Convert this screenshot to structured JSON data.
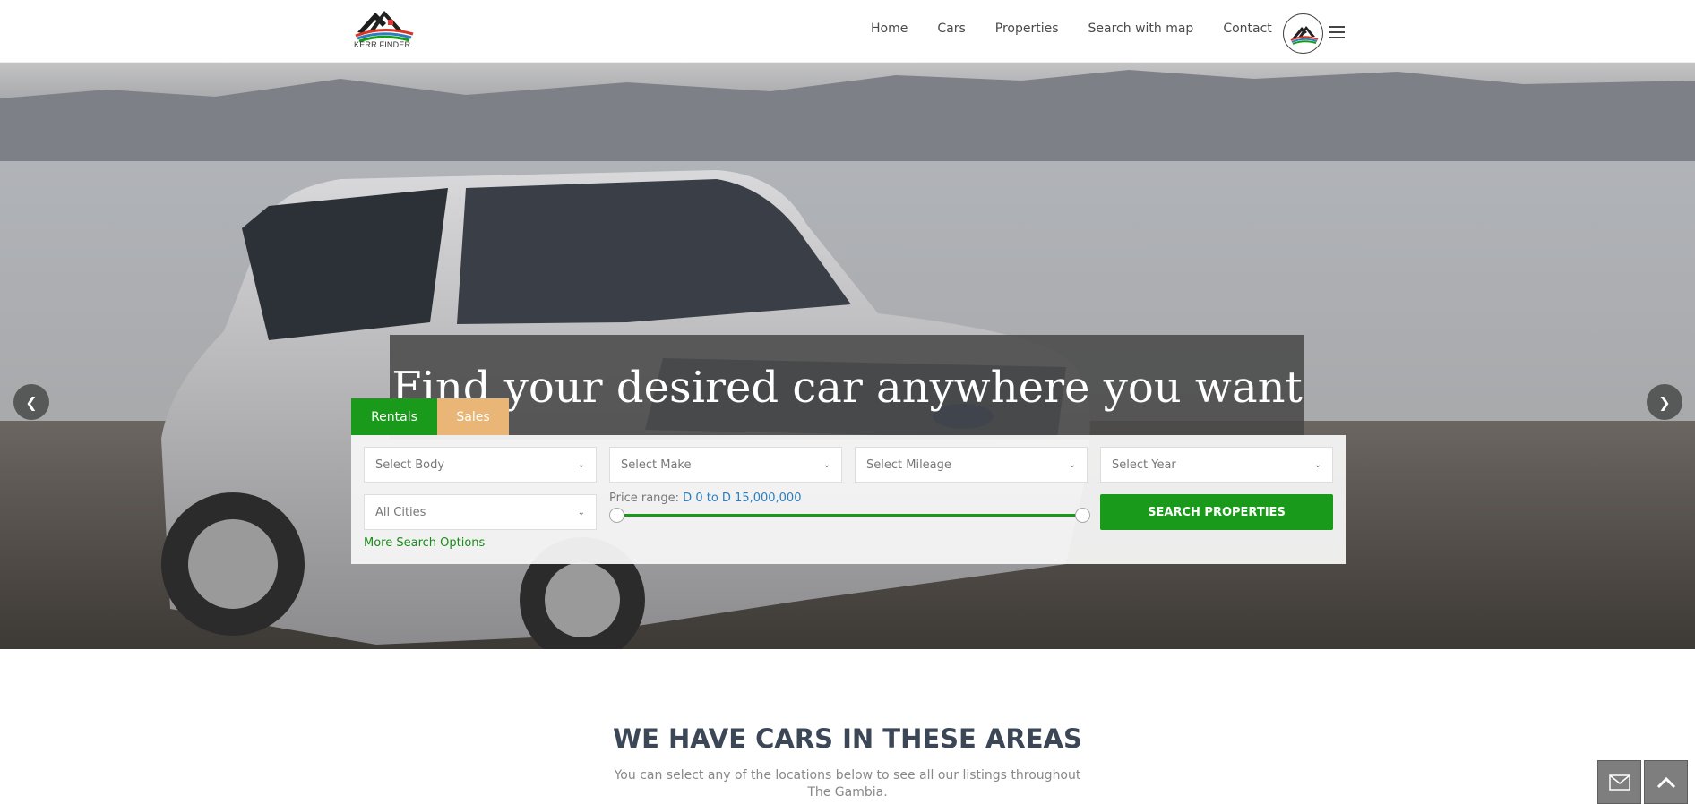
{
  "header": {
    "logo_text": "KERR FINDER",
    "nav": [
      "Home",
      "Cars",
      "Properties",
      "Search with map",
      "Contact"
    ]
  },
  "hero": {
    "headline": "Find your desired car anywhere you want",
    "prev_icon": "chevron-left-icon",
    "next_icon": "chevron-right-icon"
  },
  "search": {
    "tabs": [
      "Rentals",
      "Sales"
    ],
    "selects": {
      "body": "Select Body",
      "make": "Select Make",
      "mileage": "Select Mileage",
      "year": "Select Year",
      "city": "All Cities"
    },
    "price_label": "Price range:",
    "price_value": "D 0 to D 15,000,000",
    "price_min_fraction": 0,
    "price_max_fraction": 1,
    "button": "SEARCH PROPERTIES",
    "more_options": "More Search Options"
  },
  "section": {
    "title": "WE HAVE CARS IN THESE AREAS",
    "subtitle": "You can select any of the locations below to see all our listings throughout The Gambia."
  },
  "colors": {
    "primary_green": "#1a9a1a",
    "sales_tab": "#eab677",
    "price_value": "#2a7fc1",
    "title": "#3b4657"
  }
}
